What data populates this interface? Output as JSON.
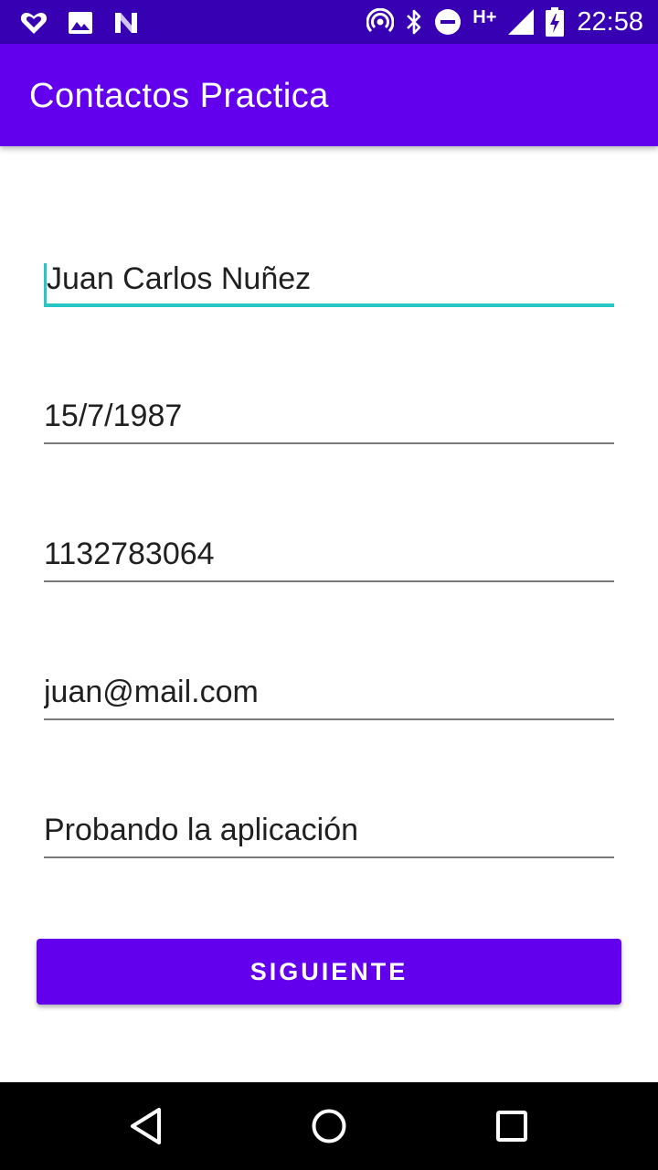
{
  "status_bar": {
    "time": "22:58",
    "network": "H+",
    "left_icons": [
      "heart-app-icon",
      "image-icon",
      "n-app-icon"
    ],
    "right_icons": [
      "hotspot-icon",
      "bluetooth-icon",
      "do-not-disturb-icon",
      "signal-icon",
      "battery-charging-icon"
    ]
  },
  "app_bar": {
    "title": "Contactos Practica"
  },
  "form": {
    "fields": [
      {
        "name": "nombre",
        "value": "Juan Carlos Nuñez",
        "focused": true
      },
      {
        "name": "fecha",
        "value": "15/7/1987",
        "focused": false
      },
      {
        "name": "telefono",
        "value": "1132783064",
        "focused": false
      },
      {
        "name": "email",
        "value": "juan@mail.com",
        "focused": false
      },
      {
        "name": "descripcion",
        "value": "Probando la aplicación",
        "focused": false
      }
    ],
    "submit_label": "SIGUIENTE"
  },
  "nav_bar": {
    "buttons": [
      "back-icon",
      "home-icon",
      "recents-icon"
    ]
  },
  "colors": {
    "status_bar": "#3700b3",
    "primary": "#6200ee",
    "accent": "#26c6c6",
    "text": "#202020",
    "underline": "#7a7a7a",
    "nav_bar": "#000000"
  }
}
